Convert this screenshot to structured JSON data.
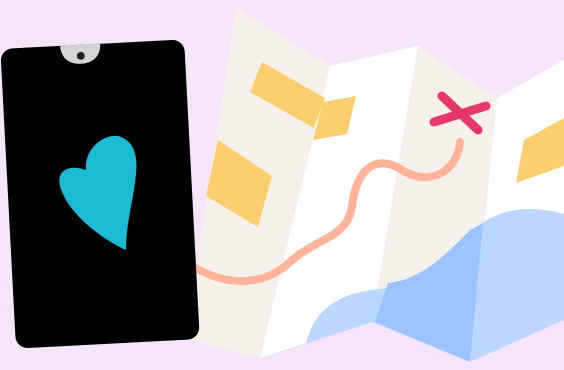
{
  "colors": {
    "background": "#f5e4fb",
    "phone_body": "#000000",
    "phone_notch": "#d4d4d4",
    "brand_heart": "#1bbbd4",
    "map_panel_light": "#f5f0ea",
    "map_panel_white": "#ffffff",
    "map_block": "#fbcf6f",
    "water_light": "#bcd7ff",
    "water_dark": "#9cc2ff",
    "route_line": "#ffb39b",
    "destination_marker": "#e63769"
  },
  "icons": {
    "phone": "smartphone-icon",
    "logo": "heart-logo-icon",
    "map": "folded-map-icon",
    "route": "route-path-icon",
    "destination": "x-marker-icon"
  }
}
